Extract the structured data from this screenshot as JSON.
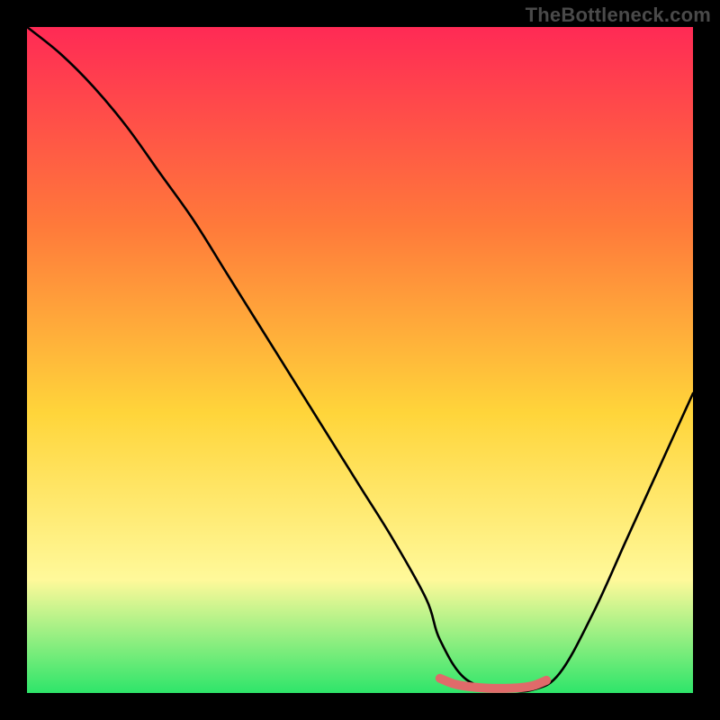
{
  "watermark": "TheBottleneck.com",
  "colors": {
    "frame": "#000000",
    "gradient_top": "#ff2a55",
    "gradient_mid1": "#ff7a3a",
    "gradient_mid2": "#ffd53a",
    "gradient_mid3": "#fff99a",
    "gradient_bottom": "#2ee56a",
    "curve": "#000000",
    "highlight": "#e06a6a"
  },
  "chart_data": {
    "type": "line",
    "title": "",
    "xlabel": "",
    "ylabel": "",
    "xlim": [
      0,
      100
    ],
    "ylim": [
      0,
      100
    ],
    "series": [
      {
        "name": "bottleneck-curve",
        "x": [
          0,
          5,
          10,
          15,
          20,
          25,
          30,
          35,
          40,
          45,
          50,
          55,
          60,
          62,
          66,
          72,
          76,
          80,
          85,
          90,
          95,
          100
        ],
        "y": [
          100,
          96,
          91,
          85,
          78,
          71,
          63,
          55,
          47,
          39,
          31,
          23,
          14,
          8,
          2,
          0.5,
          0.5,
          3,
          12,
          23,
          34,
          45
        ]
      },
      {
        "name": "optimal-range",
        "x": [
          62,
          64,
          66,
          68,
          70,
          72,
          74,
          76,
          78
        ],
        "y": [
          2.2,
          1.4,
          1.0,
          0.8,
          0.7,
          0.7,
          0.8,
          1.1,
          1.9
        ]
      }
    ],
    "annotations": []
  }
}
